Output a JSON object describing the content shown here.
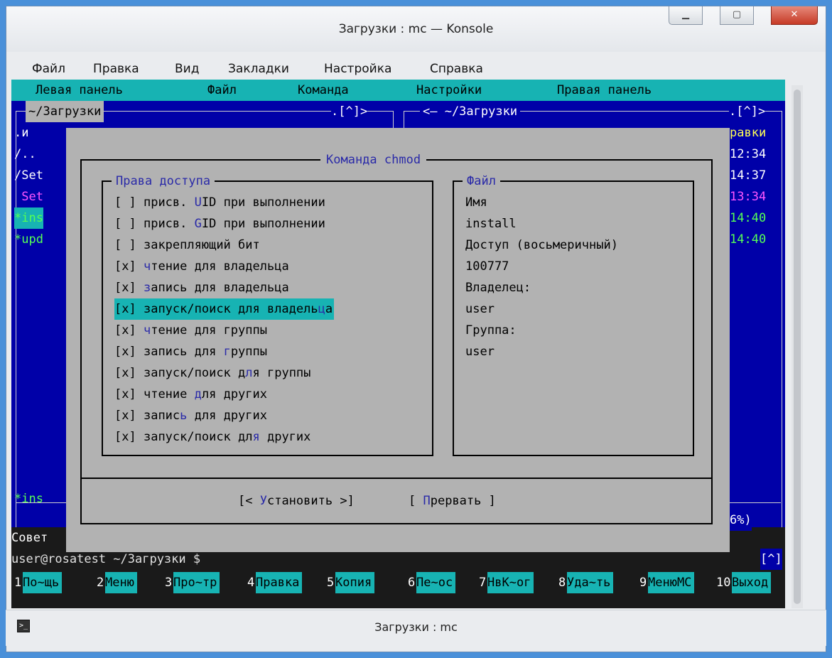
{
  "window": {
    "title": "Загрузки : mc — Konsole",
    "min_icon": "minimize-icon",
    "max_icon": "maximize-icon",
    "close_icon": "close-icon"
  },
  "konsole_menu": [
    "Файл",
    "Правка",
    "Вид",
    "Закладки",
    "Настройка",
    "Справка"
  ],
  "mc": {
    "menu": [
      "Левая панель",
      "Файл",
      "Команда",
      "Настройки",
      "Правая панель"
    ],
    "left_panel": {
      "path": "~/Загрузки",
      "scroll_ind": ".[^]>",
      "rows": [
        ".и",
        "/..",
        "/Set",
        " Set",
        "*ins",
        "*upd"
      ],
      "status": "*ins"
    },
    "right_panel": {
      "path": "<— ~/Загрузки",
      "scroll_ind": ".[^]>",
      "header": "равки",
      "times": [
        "12:34",
        "14:37",
        "13:34",
        "14:40",
        "14:40"
      ],
      "footer": "6%)"
    },
    "hint": "Совет",
    "prompt": "user@rosatest ~/Загрузки $",
    "prompt_ind": "[^]",
    "fkeys": [
      {
        "num": "1",
        "label": "По~щь"
      },
      {
        "num": "2",
        "label": "Меню"
      },
      {
        "num": "3",
        "label": "Про~тр"
      },
      {
        "num": "4",
        "label": "Правка"
      },
      {
        "num": "5",
        "label": "Копия"
      },
      {
        "num": "6",
        "label": "Пе~ос"
      },
      {
        "num": "7",
        "label": "НвК~ог"
      },
      {
        "num": "8",
        "label": "Уда~ть"
      },
      {
        "num": "9",
        "label": "МенюМС"
      },
      {
        "num": "10",
        "label": "Выход"
      }
    ]
  },
  "dialog": {
    "title": "Команда chmod",
    "perms_title": "Права доступа",
    "perms": [
      {
        "mark": "[ ]",
        "a": "присв. ",
        "h": "U",
        "b": "ID при выполнении"
      },
      {
        "mark": "[ ]",
        "a": "присв. ",
        "h": "G",
        "b": "ID при выполнении"
      },
      {
        "mark": "[ ]",
        "a": "закрепляющий бит",
        "h": "",
        "b": ""
      },
      {
        "mark": "[x]",
        "a": "",
        "h": "ч",
        "b": "тение для владельца"
      },
      {
        "mark": "[x]",
        "a": "",
        "h": "з",
        "b": "апись для владельца"
      },
      {
        "mark": "[x]",
        "a": "запуск/поиск для владель",
        "h": "ц",
        "b": "а"
      },
      {
        "mark": "[x]",
        "a": "",
        "h": "ч",
        "b": "тение для группы"
      },
      {
        "mark": "[x]",
        "a": "запись для ",
        "h": "г",
        "b": "руппы"
      },
      {
        "mark": "[x]",
        "a": "запуск/поиск д",
        "h": "л",
        "b": "я группы"
      },
      {
        "mark": "[x]",
        "a": "чтение ",
        "h": "д",
        "b": "ля других"
      },
      {
        "mark": "[x]",
        "a": "запис",
        "h": "ь",
        "b": " для других"
      },
      {
        "mark": "[x]",
        "a": "запуск/поиск дл",
        "h": "я",
        "b": " других"
      }
    ],
    "selected_index": 5,
    "file_title": "Файл",
    "file_lines": [
      "Имя",
      "install",
      "Доступ (восьмеричный)",
      "100777",
      "Владелец:",
      "user",
      "Группа:",
      "user"
    ],
    "btn_set": {
      "pre": "[< ",
      "hot": "У",
      "rest": "становить",
      "post": " >]"
    },
    "btn_cancel": {
      "pre": "[ ",
      "hot": "П",
      "rest": "рервать",
      "post": " ]"
    }
  },
  "status_text": "Загрузки : mc",
  "colors": {
    "mc_blue": "#0000a8",
    "mc_cyan": "#17b3b3",
    "dialog_gray": "#b2b2b2",
    "dialog_hotkey": "#2a2aa8",
    "panel_magenta": "#ff55ff",
    "panel_green": "#55ff55"
  }
}
